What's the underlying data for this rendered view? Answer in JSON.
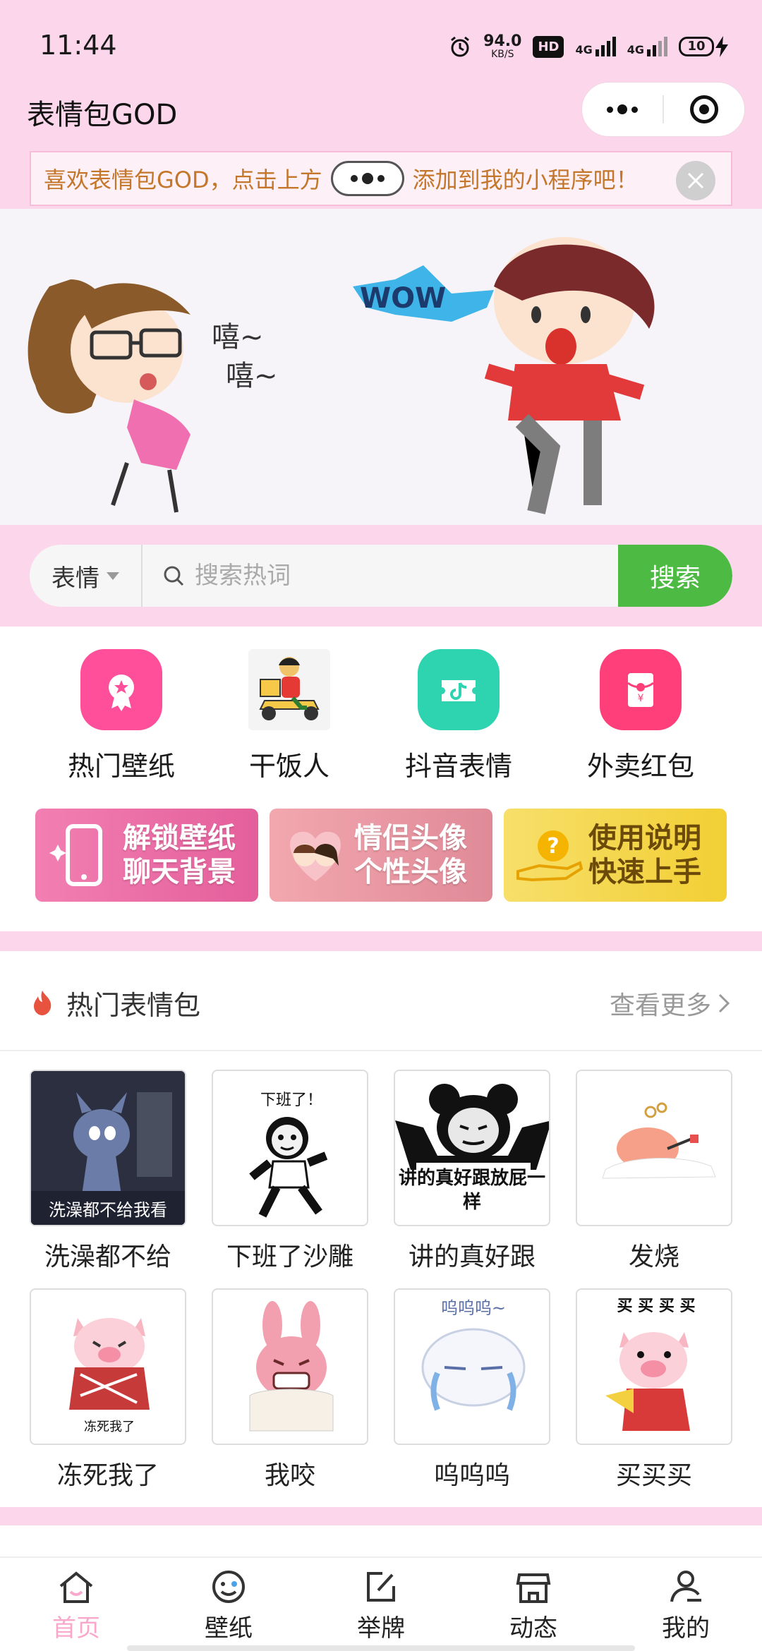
{
  "status_bar": {
    "time": "11:44",
    "speed_value": "94.0",
    "speed_unit": "KB/S",
    "hd": "HD",
    "net1": "4G",
    "net2": "4G",
    "battery": "10"
  },
  "app": {
    "title": "表情包GOD"
  },
  "tip": {
    "before": "喜欢表情包GOD，点击上方",
    "after": "添加到我的小程序吧！"
  },
  "search": {
    "category": "表情",
    "placeholder": "搜索热词",
    "button": "搜索"
  },
  "menu": [
    {
      "label": "热门壁纸",
      "icon": "award-icon",
      "color": "#ff4f9a"
    },
    {
      "label": "干饭人",
      "icon": "delivery-rider-icon"
    },
    {
      "label": "抖音表情",
      "icon": "tiktok-ticket-icon",
      "color": "#2ed3b0"
    },
    {
      "label": "外卖红包",
      "icon": "red-envelope-icon",
      "color": "#ff3f7a"
    }
  ],
  "cards": [
    {
      "line1": "解锁壁纸",
      "line2": "聊天背景",
      "color": "#ee6aa5"
    },
    {
      "line1": "情侣头像",
      "line2": "个性头像",
      "color": "#e78d9b"
    },
    {
      "line1": "使用说明",
      "line2": "快速上手",
      "color": "#f4d43c"
    }
  ],
  "section": {
    "title": "热门表情包",
    "more": "查看更多"
  },
  "stickers": [
    {
      "caption": "洗澡都不给",
      "image_text": "洗澡都不给我看"
    },
    {
      "caption": "下班了沙雕",
      "image_text": "下班了！"
    },
    {
      "caption": "讲的真好跟",
      "image_text": "讲的真好跟放屁一样"
    },
    {
      "caption": "发烧",
      "image_text": ""
    },
    {
      "caption": "冻死我了",
      "image_text": "冻死我了"
    },
    {
      "caption": "我咬",
      "image_text": ""
    },
    {
      "caption": "呜呜呜",
      "image_text": "呜呜呜~"
    },
    {
      "caption": "买买买",
      "image_text": "买 买 买 买"
    }
  ],
  "tabs": [
    {
      "label": "首页",
      "icon": "home-icon",
      "active": true
    },
    {
      "label": "壁纸",
      "icon": "smile-icon"
    },
    {
      "label": "举牌",
      "icon": "edit-icon"
    },
    {
      "label": "动态",
      "icon": "store-icon"
    },
    {
      "label": "我的",
      "icon": "user-icon"
    }
  ],
  "banner": {
    "left_text": "嘻~ 嘻~",
    "right_text": "WOW"
  }
}
